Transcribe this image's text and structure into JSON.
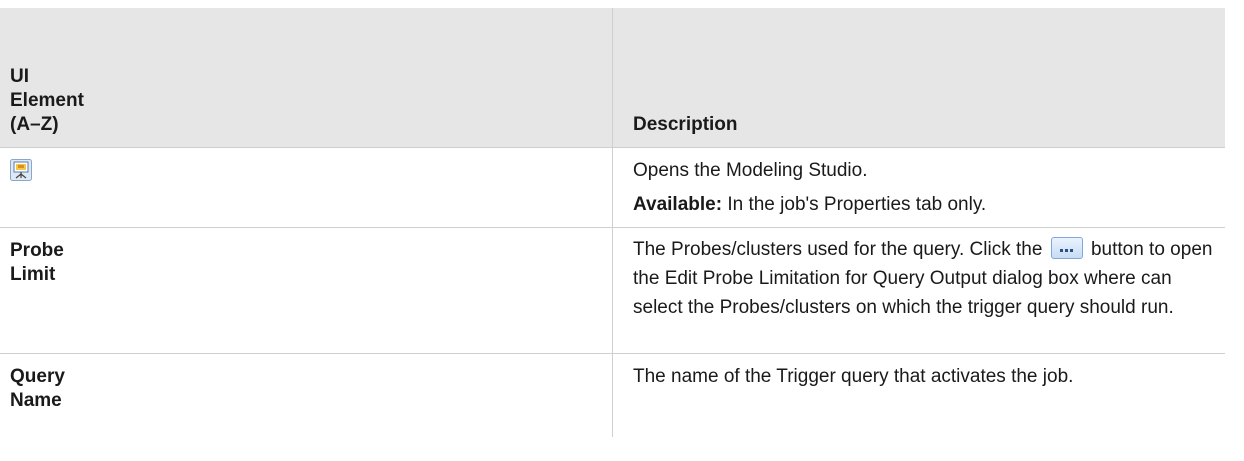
{
  "table": {
    "header": {
      "col_a_lines": [
        "UI",
        "Element",
        "(A–Z)"
      ],
      "col_b": "Description"
    },
    "rows": [
      {
        "element_icon": "modeling-studio-icon",
        "description_1": "Opens the Modeling Studio.",
        "available_label": "Available:",
        "available_text": " In the job's Properties tab only."
      },
      {
        "element_lines": [
          "Probe",
          "Limit"
        ],
        "desc_before": "The Probes/clusters used for the query. Click the ",
        "button_icon": "ellipsis-button-icon",
        "desc_after": " button to open the Edit Probe Limitation for Query Output dialog box where can select the Probes/clusters on which the trigger query should run."
      },
      {
        "element_lines": [
          "Query",
          "Name"
        ],
        "description": "The name of the Trigger query that activates the job."
      }
    ]
  }
}
